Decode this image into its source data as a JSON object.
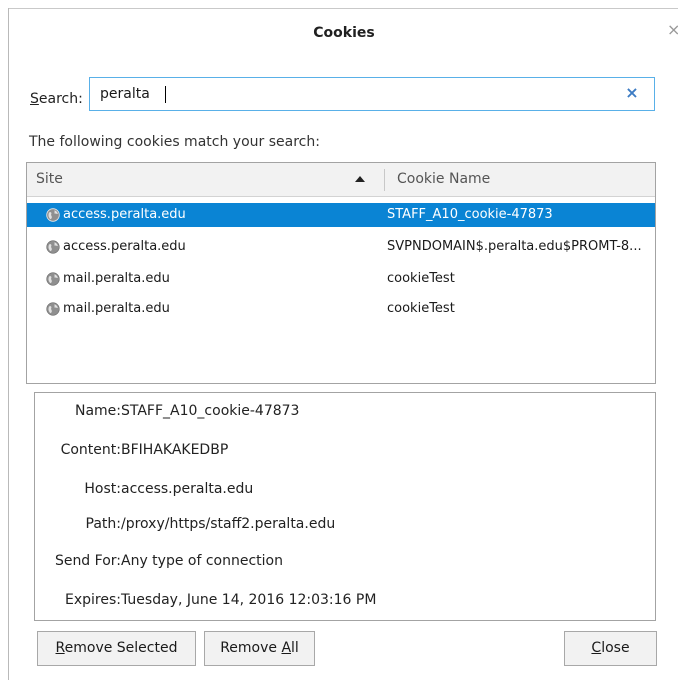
{
  "dialog": {
    "title": "Cookies",
    "close_glyph": "×"
  },
  "search": {
    "label_accesskey": "S",
    "label_rest": "earch:",
    "value": "peralta",
    "clear_glyph": "×"
  },
  "match_text": "The following cookies match your search:",
  "table": {
    "columns": {
      "site": "Site",
      "cookie_name": "Cookie Name"
    },
    "sort": "ascending",
    "rows": [
      {
        "site": "access.peralta.edu",
        "name": "STAFF_A10_cookie-47873",
        "selected": true
      },
      {
        "site": "access.peralta.edu",
        "name": "SVPNDOMAIN$.peralta.edu$PROMT-8...",
        "selected": false
      },
      {
        "site": "mail.peralta.edu",
        "name": "cookieTest",
        "selected": false
      },
      {
        "site": "mail.peralta.edu",
        "name": "cookieTest",
        "selected": false
      }
    ]
  },
  "details": {
    "name_label": "Name:",
    "name_value": "STAFF_A10_cookie-47873",
    "content_label": "Content:",
    "content_value": "BFIHAKAKEDBP",
    "host_label": "Host:",
    "host_value": "access.peralta.edu",
    "path_label": "Path:",
    "path_value": "/proxy/https/staff2.peralta.edu",
    "sendfor_label": "Send For:",
    "sendfor_value": "Any type of connection",
    "expires_label": "Expires:",
    "expires_value": "Tuesday, June 14, 2016 12:03:16 PM"
  },
  "buttons": {
    "remove_selected": {
      "accesskey": "R",
      "rest": "emove Selected"
    },
    "remove_all": {
      "before": "Remove ",
      "accesskey": "A",
      "rest": "ll"
    },
    "close": {
      "accesskey": "C",
      "rest": "lose"
    }
  },
  "colors": {
    "selection": "#0a84d4",
    "focus_border": "#59b0e8",
    "clear_icon": "#3d7cc4"
  },
  "icons": {
    "row_icon": "globe-icon",
    "clear": "clear-search-icon",
    "close": "close-icon",
    "sort": "sort-ascending-icon"
  }
}
